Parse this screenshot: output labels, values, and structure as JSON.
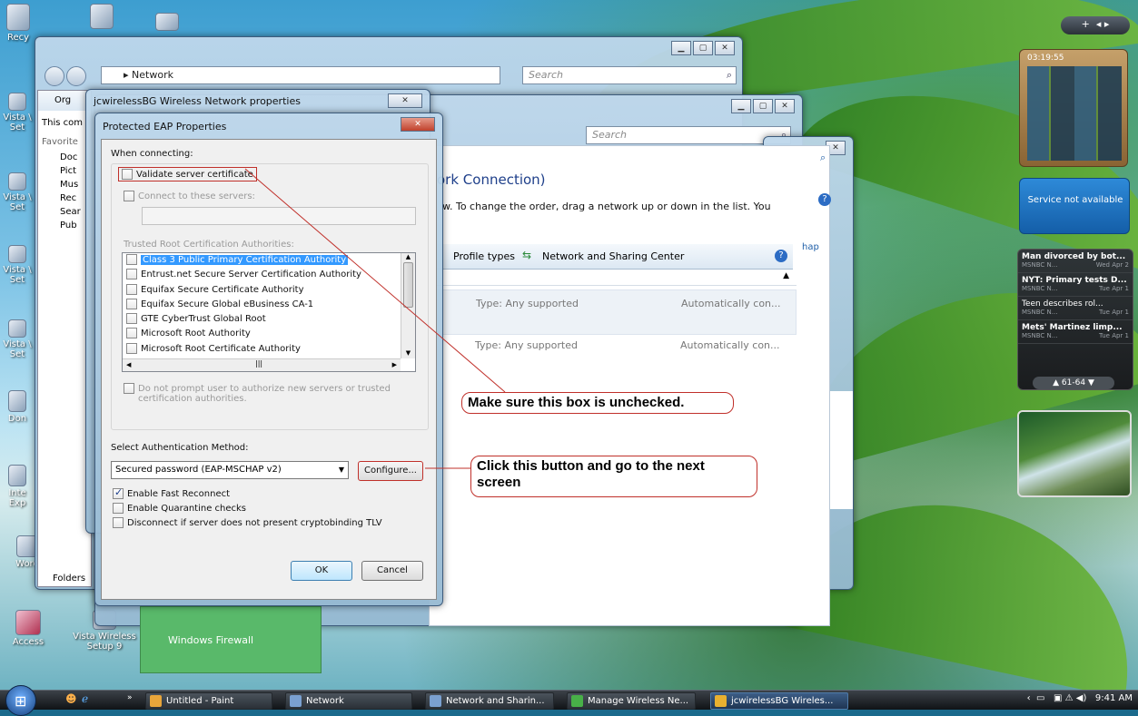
{
  "desktop_icons": [
    {
      "label": "Recy",
      "name": "recycle-bin"
    },
    {
      "label": "Vista \\ Set",
      "name": "vista-setup-1"
    },
    {
      "label": "Vista \\ Set",
      "name": "vista-setup-2"
    },
    {
      "label": "Vista \\ Set",
      "name": "vista-setup-3"
    },
    {
      "label": "Vista \\ Set",
      "name": "vista-setup-4"
    },
    {
      "label": "Don",
      "name": "documents"
    },
    {
      "label": "Inte Exp",
      "name": "internet-explorer"
    },
    {
      "label": "Word",
      "name": "word"
    },
    {
      "label": "Access",
      "name": "access"
    },
    {
      "label": "Vista Wireless Setup 9",
      "name": "vista-wireless-setup"
    }
  ],
  "explorer_network": {
    "address": "Network",
    "search_placeholder": "Search",
    "organize_label": "Org",
    "this_computer": "This com",
    "favorites_header": "Favorite",
    "fav_items": [
      "Doc",
      "Pict",
      "Mus",
      "Rec",
      "Sear",
      "Pub"
    ],
    "folders_label": "Folders"
  },
  "manage_wireless": {
    "search_placeholder": "Search",
    "heading_fragment": "ork Connection)",
    "instruction": "w. To change the order, drag a network up or down in the list. You",
    "profile_types": "Profile types",
    "network_sharing_center": "Network and Sharing Center",
    "rows": [
      {
        "type": "Type: Any supported",
        "mode": "Automatically con..."
      },
      {
        "type": "Type: Any supported",
        "mode": "Automatically con..."
      }
    ],
    "map_fragment": "hap"
  },
  "windows_firewall": "Windows Firewall",
  "wireless_props": {
    "title": "jcwirelessBG Wireless Network properties"
  },
  "peap": {
    "title": "Protected EAP Properties",
    "when_connecting": "When connecting:",
    "validate_cert": "Validate server certificate",
    "connect_servers": "Connect to these servers:",
    "trusted_root_header": "Trusted Root Certification Authorities:",
    "cert_list": [
      "Class 3 Public Primary Certification Authority",
      "Entrust.net Secure Server Certification Authority",
      "Equifax Secure Certificate Authority",
      "Equifax Secure Global eBusiness CA-1",
      "GTE CyberTrust Global Root",
      "Microsoft Root Authority",
      "Microsoft Root Certificate Authority"
    ],
    "no_prompt": "Do not prompt user to authorize new servers or trusted",
    "no_prompt_2": "certification authorities.",
    "select_auth": "Select Authentication Method:",
    "auth_method": "Secured password (EAP-MSCHAP v2)",
    "configure": "Configure...",
    "fast_reconnect": "Enable Fast Reconnect",
    "quarantine": "Enable Quarantine checks",
    "disconnect_tlv": "Disconnect if server does not present cryptobinding TLV",
    "ok": "OK",
    "cancel": "Cancel"
  },
  "callouts": {
    "unchecked": "Make sure this box is unchecked.",
    "configure_1": "Click this button and go to the next",
    "configure_2": "screen"
  },
  "sidebar": {
    "clock": "03:19:55",
    "service": "Service not available",
    "news": [
      {
        "headline": "Man divorced by bot...",
        "source": "MSNBC N...",
        "date": "Wed Apr 2"
      },
      {
        "headline": "NYT: Primary tests D...",
        "source": "MSNBC N...",
        "date": "Tue Apr 1"
      },
      {
        "headline": "Teen describes rol...",
        "source": "MSNBC N...",
        "date": "Tue Apr 1"
      },
      {
        "headline": "Mets' Martinez limp...",
        "source": "MSNBC N...",
        "date": "Tue Apr 1"
      }
    ],
    "pager": "61-64"
  },
  "taskbar": {
    "items": [
      "Untitled - Paint",
      "Network",
      "Network and Sharin...",
      "Manage Wireless Ne...",
      "jcwirelessBG Wireles..."
    ],
    "time": "9:41 AM"
  },
  "colors": {
    "callout_border": "#c0302a",
    "selection": "#3399ff",
    "firewall_green": "#59b96a"
  }
}
